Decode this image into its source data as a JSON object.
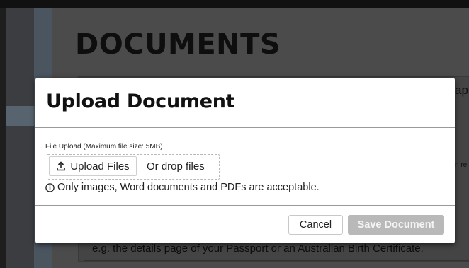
{
  "background": {
    "page_title": "DOCUMENTS",
    "fragment_right": "ap",
    "fragment_right_small": "n re",
    "caption": "e.g. the details page of your Passport or an Australian Birth Certificate."
  },
  "modal": {
    "title": "Upload Document",
    "upload_label": "File Upload (Maximum file size: 5MB)",
    "upload_button_label": "Upload Files",
    "drop_text": "Or drop files",
    "hint_text": "Only images, Word documents and PDFs are acceptable.",
    "cancel_label": "Cancel",
    "save_label": "Save Document",
    "save_enabled": false
  },
  "colors": {
    "overlay": "#1e1e1e",
    "modal_bg": "#ffffff",
    "save_disabled": "#b9b9b9"
  },
  "icons": {
    "upload": "upload-icon",
    "info": "info-circle-icon"
  }
}
